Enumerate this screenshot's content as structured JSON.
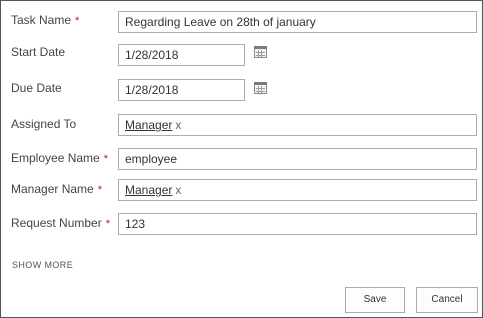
{
  "form": {
    "task_name": {
      "label": "Task Name",
      "required_mark": "*",
      "value": "Regarding Leave on 28th of january"
    },
    "start_date": {
      "label": "Start Date",
      "value": "1/28/2018"
    },
    "due_date": {
      "label": "Due Date",
      "value": "1/28/2018"
    },
    "assigned_to": {
      "label": "Assigned To",
      "person": "Manager",
      "remove": "x"
    },
    "employee_name": {
      "label": "Employee Name",
      "required_mark": "*",
      "value": "employee"
    },
    "manager_name": {
      "label": "Manager Name",
      "required_mark": "*",
      "person": "Manager",
      "remove": "x"
    },
    "request_number": {
      "label": "Request Number",
      "required_mark": "*",
      "value": "123"
    }
  },
  "links": {
    "show_more": "SHOW MORE"
  },
  "buttons": {
    "save": "Save",
    "cancel": "Cancel"
  },
  "icons": {
    "calendar": "calendar-icon"
  },
  "colors": {
    "required_mark": "#a4262c",
    "border": "#ababab"
  }
}
